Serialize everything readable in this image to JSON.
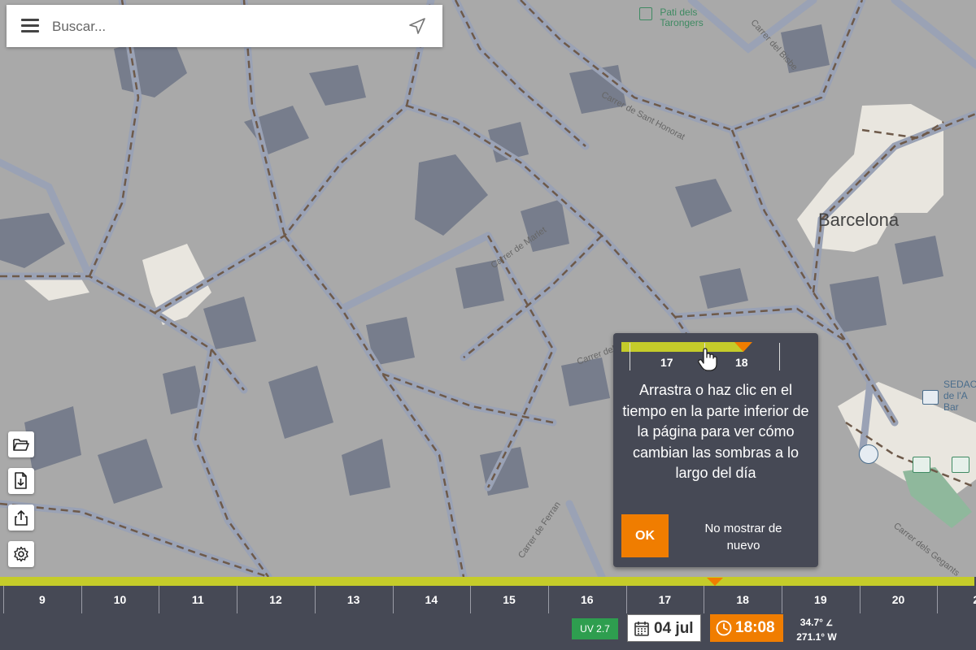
{
  "search": {
    "placeholder": "Buscar..."
  },
  "map": {
    "city_label": "Barcelona",
    "poi_label": "Pati dels Tarongers",
    "poi_label_lines": [
      "Pati dels",
      "Tarongers"
    ],
    "partial_label_lines": [
      "SEDAC",
      "de l'A",
      "Bar"
    ],
    "streets": [
      "Carrer del Bisbe",
      "Carrer de Sant Honorat",
      "Carrer de Marlet",
      "Carrer del Call",
      "Carrer de Ferran",
      "Carrer dels Gegants"
    ]
  },
  "tools": {
    "icons": [
      "folder-open-icon",
      "file-download-icon",
      "share-icon",
      "gear-icon"
    ]
  },
  "tooltip": {
    "hour_left": "17",
    "hour_right": "18",
    "message": "Arrastra o haz clic en el tiempo en la parte inferior de la página para ver cómo cambian las sombras a lo largo del día",
    "ok_label": "OK",
    "dont_show_label": "No mostrar de nuevo"
  },
  "timeline": {
    "hours": [
      "9",
      "10",
      "11",
      "12",
      "13",
      "14",
      "15",
      "16",
      "17",
      "18",
      "19",
      "20",
      "2"
    ],
    "current_hour": "18"
  },
  "status": {
    "uv": "UV 2.7",
    "date": "04 jul",
    "time": "18:08",
    "sun_altitude": "34.7°",
    "sun_azimuth": "271.1° W"
  },
  "colors": {
    "accent": "#f07d00",
    "timeline_bar": "#c5cc2a",
    "panel": "#464955",
    "uv_badge": "#2e9e4f",
    "map_ground": "#a9a9a9",
    "shadow": "#6f7687",
    "street": "#9aa2b5"
  }
}
